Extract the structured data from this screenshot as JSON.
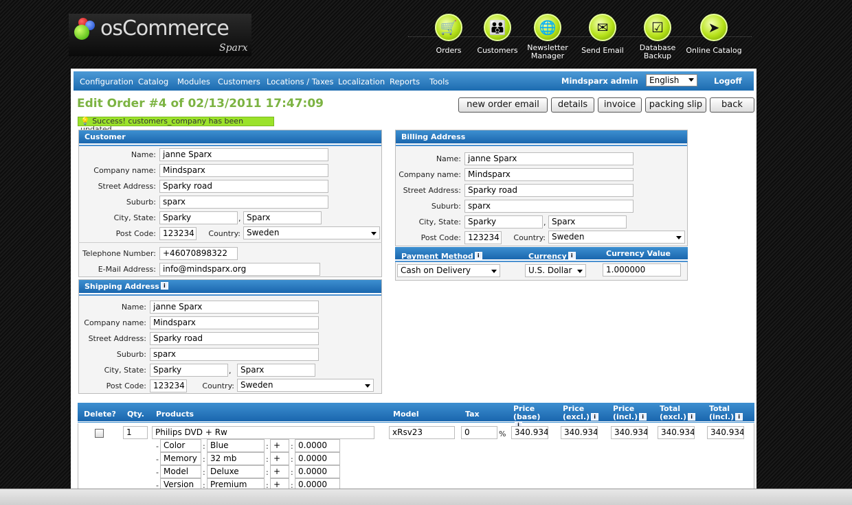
{
  "logo": {
    "brand": "osCommerce",
    "sub": "Sparx"
  },
  "header_icons": [
    {
      "label": "Orders",
      "icon": "shopping-cart-icon",
      "glyph": "🛒"
    },
    {
      "label": "Customers",
      "icon": "people-icon",
      "glyph": "👪"
    },
    {
      "label": "Newsletter Manager",
      "icon": "globe-icon",
      "glyph": "🌐"
    },
    {
      "label": "Send Email",
      "icon": "envelope-icon",
      "glyph": "✉"
    },
    {
      "label": "Database Backup",
      "icon": "checkbox-icon",
      "glyph": "☑"
    },
    {
      "label": "Online Catalog",
      "icon": "play-arrow-icon",
      "glyph": "➤"
    }
  ],
  "menu": {
    "items": [
      "Configuration",
      "Catalog",
      "Modules",
      "Customers",
      "Locations / Taxes",
      "Localization",
      "Reports",
      "Tools"
    ],
    "admin": "Mindsparx admin",
    "language": "English",
    "logoff": "Logoff"
  },
  "page": {
    "title": "Edit Order #4 of 02/13/2011 17:47:09",
    "success": "Success! customers_company has been updated"
  },
  "buttons": [
    "new order email",
    "details",
    "invoice",
    "packing slip",
    "back"
  ],
  "labels": {
    "name": "Name:",
    "company": "Company name:",
    "street": "Street Address:",
    "suburb": "Suburb:",
    "city_state": "City, State:",
    "postcode": "Post Code:",
    "country": "Country:",
    "telephone": "Telephone Number:",
    "email": "E-Mail Address:",
    "comma": ","
  },
  "customer": {
    "header": "Customer",
    "name": "janne Sparx",
    "company": "Mindsparx",
    "street": "Sparky road",
    "suburb": "sparx",
    "city": "Sparky",
    "state": "Sparx",
    "postcode": "123234",
    "country": "Sweden",
    "telephone": "+46070898322",
    "email": "info@mindsparx.org"
  },
  "shipping": {
    "header": "Shipping Address",
    "name": "janne Sparx",
    "company": "Mindsparx",
    "street": "Sparky road",
    "suburb": "sparx",
    "city": "Sparky",
    "state": "Sparx",
    "postcode": "123234",
    "country": "Sweden"
  },
  "billing": {
    "header": "Billing Address",
    "name": "janne Sparx",
    "company": "Mindsparx",
    "street": "Sparky road",
    "suburb": "sparx",
    "city": "Sparky",
    "state": "Sparx",
    "postcode": "123234",
    "country": "Sweden"
  },
  "payment": {
    "method_label": "Payment Method",
    "currency_label": "Currency",
    "currency_value_label": "Currency Value",
    "method": "Cash on Delivery",
    "currency": "U.S. Dollar",
    "currency_value": "1.000000"
  },
  "products": {
    "headers": {
      "delete": "Delete?",
      "qty": "Qty.",
      "products": "Products",
      "model": "Model",
      "tax": "Tax",
      "price_base": "Price (base)",
      "price_excl": "Price (excl.)",
      "price_incl": "Price (incl.)",
      "total_excl": "Total (excl.)",
      "total_incl": "Total (incl.)"
    },
    "row": {
      "qty": "1",
      "name": "Philips DVD + Rw",
      "model": "xRsv23",
      "tax": "0",
      "pct": "%",
      "price_base": "340.934",
      "price_excl": "340.934",
      "price_incl": "340.934",
      "total_excl": "340.934",
      "total_incl": "340.934"
    },
    "attributes": [
      {
        "name": "Color",
        "value": "Blue",
        "prefix": "+",
        "price": "0.0000"
      },
      {
        "name": "Memory",
        "value": "32 mb",
        "prefix": "+",
        "price": "0.0000"
      },
      {
        "name": "Model",
        "value": "Deluxe",
        "prefix": "+",
        "price": "0.0000"
      },
      {
        "name": "Version",
        "value": "Premium",
        "prefix": "+",
        "price": "0.0000"
      }
    ],
    "attr_dash": "-",
    "attr_colon": ":"
  },
  "colors": {
    "accent": "#1c6bb0",
    "title": "#7cb342",
    "success": "#9be22a"
  }
}
